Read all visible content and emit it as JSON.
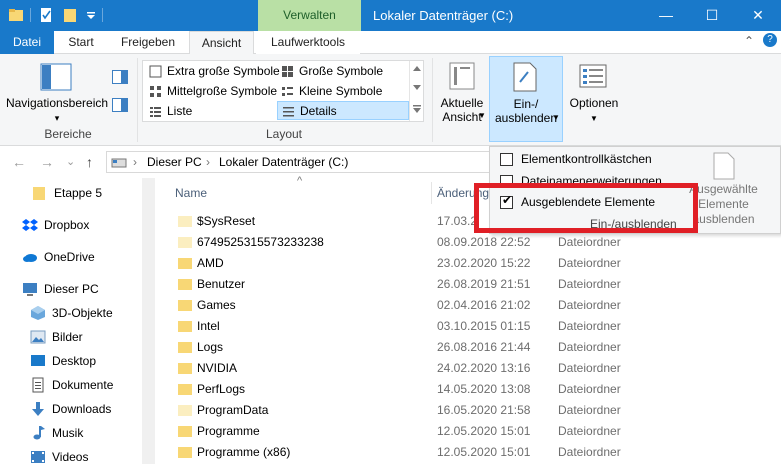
{
  "titlebar": {
    "context_tab": "Verwalten",
    "title": "Lokaler Datenträger (C:)",
    "minimize_glyph": "—",
    "maximize_glyph": "☐",
    "close_glyph": "✕"
  },
  "tabs": {
    "datei": "Datei",
    "start": "Start",
    "freigeben": "Freigeben",
    "ansicht": "Ansicht",
    "laufwerktools": "Laufwerktools",
    "collapse_glyph": "⌃",
    "help_glyph": "?"
  },
  "ribbon": {
    "bereiche": {
      "label": "Bereiche",
      "navigationsbereich": "Navigationsbereich",
      "arrow": "▾"
    },
    "layout": {
      "label": "Layout",
      "options": [
        "Extra große Symbole",
        "Große Symbole",
        "Mittelgroße Symbole",
        "Kleine Symbole",
        "Liste",
        "Details"
      ]
    },
    "aktuelle_ansicht": "Aktuelle\nAnsicht",
    "ein_ausblenden": "Ein-/\nausblenden",
    "optionen": "Optionen"
  },
  "nav": {
    "back": "←",
    "forward": "→",
    "recent": "⌄",
    "up": "↑",
    "breadcrumb_sep": "›",
    "breadcrumb": [
      "Dieser PC",
      "Lokaler Datenträger (C:)"
    ]
  },
  "sidebar": {
    "items": [
      {
        "label": "Etappe 5",
        "icon": "folder-icon"
      },
      {
        "label": "Dropbox",
        "icon": "dropbox-icon"
      },
      {
        "label": "OneDrive",
        "icon": "onedrive-icon"
      },
      {
        "label": "Dieser PC",
        "icon": "computer-icon"
      },
      {
        "label": "3D-Objekte",
        "icon": "3d-objects-icon"
      },
      {
        "label": "Bilder",
        "icon": "pictures-icon"
      },
      {
        "label": "Desktop",
        "icon": "desktop-icon"
      },
      {
        "label": "Dokumente",
        "icon": "documents-icon"
      },
      {
        "label": "Downloads",
        "icon": "downloads-icon"
      },
      {
        "label": "Musik",
        "icon": "music-icon"
      },
      {
        "label": "Videos",
        "icon": "videos-icon"
      }
    ]
  },
  "filelist": {
    "col_name": "Name",
    "col_date": "Änderungsdatum",
    "sort_glyph": "^",
    "rows": [
      {
        "name": "$SysReset",
        "date": "17.03.2",
        "type": "",
        "faded": true
      },
      {
        "name": "6749525315573233238",
        "date": "08.09.2018 22:52",
        "type": "Dateiordner",
        "faded": true
      },
      {
        "name": "AMD",
        "date": "23.02.2020 15:22",
        "type": "Dateiordner",
        "faded": false
      },
      {
        "name": "Benutzer",
        "date": "26.08.2019 21:51",
        "type": "Dateiordner",
        "faded": false
      },
      {
        "name": "Games",
        "date": "02.04.2016 21:02",
        "type": "Dateiordner",
        "faded": false
      },
      {
        "name": "Intel",
        "date": "03.10.2015 01:15",
        "type": "Dateiordner",
        "faded": false
      },
      {
        "name": "Logs",
        "date": "26.08.2016 21:44",
        "type": "Dateiordner",
        "faded": false
      },
      {
        "name": "NVIDIA",
        "date": "24.02.2020 13:16",
        "type": "Dateiordner",
        "faded": false
      },
      {
        "name": "PerfLogs",
        "date": "14.05.2020 13:08",
        "type": "Dateiordner",
        "faded": false
      },
      {
        "name": "ProgramData",
        "date": "16.05.2020 21:58",
        "type": "Dateiordner",
        "faded": true
      },
      {
        "name": "Programme",
        "date": "12.05.2020 15:01",
        "type": "Dateiordner",
        "faded": false
      },
      {
        "name": "Programme (x86)",
        "date": "12.05.2020 15:01",
        "type": "Dateiordner",
        "faded": false
      }
    ]
  },
  "dropdown": {
    "items": [
      {
        "label": "Elementkontrollkästchen",
        "checked": false
      },
      {
        "label": "Dateinamenerweiterungen",
        "checked": false
      },
      {
        "label": "Ausgeblendete Elemente",
        "checked": true
      }
    ],
    "check_glyph": "✔",
    "group_label": "Ein-/ausblenden",
    "hide_selected": "Ausgewählte\nElemente ausblenden"
  },
  "colors": {
    "titlebar": "#1979ca",
    "context_tab": "#b9e0a5",
    "selection": "#cce8ff",
    "highlight_box": "#e01f26",
    "folder": "#f8d775"
  }
}
